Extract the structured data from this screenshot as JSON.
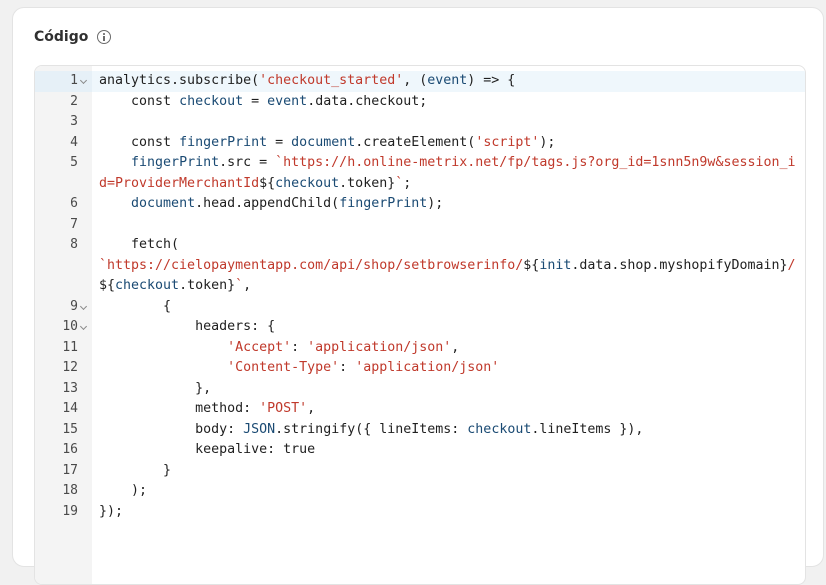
{
  "card": {
    "title": "Código",
    "info_icon": "info-circle-icon"
  },
  "colors": {
    "string": "#c0392b",
    "identifier": "#1a4a73",
    "text": "#1f1f1f",
    "gutter": "#f4f4f4",
    "active_line": "#eff7fc"
  },
  "editor": {
    "lines": [
      {
        "n": "1",
        "fold": true,
        "active": true,
        "tokens": [
          [
            "t",
            "analytics.subscribe("
          ],
          [
            "s",
            "'checkout_started'"
          ],
          [
            "t",
            ", ("
          ],
          [
            "v",
            "event"
          ],
          [
            "t",
            ") => {"
          ]
        ]
      },
      {
        "n": "2",
        "tokens": [
          [
            "t",
            "    const "
          ],
          [
            "v",
            "checkout"
          ],
          [
            "t",
            " = "
          ],
          [
            "v",
            "event"
          ],
          [
            "t",
            ".data.checkout;"
          ]
        ]
      },
      {
        "n": "3",
        "tokens": []
      },
      {
        "n": "4",
        "tokens": [
          [
            "t",
            "    const "
          ],
          [
            "v",
            "fingerPrint"
          ],
          [
            "t",
            " = "
          ],
          [
            "v",
            "document"
          ],
          [
            "t",
            ".createElement("
          ],
          [
            "s",
            "'script'"
          ],
          [
            "t",
            ");"
          ]
        ]
      },
      {
        "n": "5",
        "tokens": [
          [
            "t",
            "    "
          ],
          [
            "v",
            "fingerPrint"
          ],
          [
            "t",
            ".src = "
          ],
          [
            "s",
            "`https://h.online-metrix.net/fp/tags.js?org_id=1snn5n9w&session_id=ProviderMerchantId"
          ],
          [
            "t",
            "${"
          ],
          [
            "v",
            "checkout"
          ],
          [
            "t",
            ".token}"
          ],
          [
            "s",
            "`"
          ],
          [
            "t",
            ";"
          ]
        ]
      },
      {
        "n": "6",
        "tokens": [
          [
            "t",
            "    "
          ],
          [
            "v",
            "document"
          ],
          [
            "t",
            ".head.appendChild("
          ],
          [
            "v",
            "fingerPrint"
          ],
          [
            "t",
            ");"
          ]
        ]
      },
      {
        "n": "7",
        "tokens": []
      },
      {
        "n": "8",
        "tokens": [
          [
            "t",
            "    fetch(\n"
          ],
          [
            "s",
            "`https://cielopaymentapp.com/api/shop/setbrowserinfo/"
          ],
          [
            "t",
            "${"
          ],
          [
            "v",
            "init"
          ],
          [
            "t",
            ".data.shop.myshopifyDomain}"
          ],
          [
            "s",
            "/"
          ],
          [
            "t",
            "\n${"
          ],
          [
            "v",
            "checkout"
          ],
          [
            "t",
            ".token}"
          ],
          [
            "s",
            "`"
          ],
          [
            "t",
            ","
          ]
        ]
      },
      {
        "n": "9",
        "fold": true,
        "tokens": [
          [
            "t",
            "        {"
          ]
        ]
      },
      {
        "n": "10",
        "fold": true,
        "tokens": [
          [
            "t",
            "            headers: {"
          ]
        ]
      },
      {
        "n": "11",
        "tokens": [
          [
            "t",
            "                "
          ],
          [
            "s",
            "'Accept'"
          ],
          [
            "t",
            ": "
          ],
          [
            "s",
            "'application/json'"
          ],
          [
            "t",
            ","
          ]
        ]
      },
      {
        "n": "12",
        "tokens": [
          [
            "t",
            "                "
          ],
          [
            "s",
            "'Content-Type'"
          ],
          [
            "t",
            ": "
          ],
          [
            "s",
            "'application/json'"
          ]
        ]
      },
      {
        "n": "13",
        "tokens": [
          [
            "t",
            "            },"
          ]
        ]
      },
      {
        "n": "14",
        "tokens": [
          [
            "t",
            "            method: "
          ],
          [
            "s",
            "'POST'"
          ],
          [
            "t",
            ","
          ]
        ]
      },
      {
        "n": "15",
        "tokens": [
          [
            "t",
            "            body: "
          ],
          [
            "v",
            "JSON"
          ],
          [
            "t",
            ".stringify({ lineItems: "
          ],
          [
            "v",
            "checkout"
          ],
          [
            "t",
            ".lineItems }),"
          ]
        ]
      },
      {
        "n": "16",
        "tokens": [
          [
            "t",
            "            keepalive: true"
          ]
        ]
      },
      {
        "n": "17",
        "tokens": [
          [
            "t",
            "        }"
          ]
        ]
      },
      {
        "n": "18",
        "tokens": [
          [
            "t",
            "    );"
          ]
        ]
      },
      {
        "n": "19",
        "tokens": [
          [
            "t",
            "});"
          ]
        ]
      }
    ]
  }
}
